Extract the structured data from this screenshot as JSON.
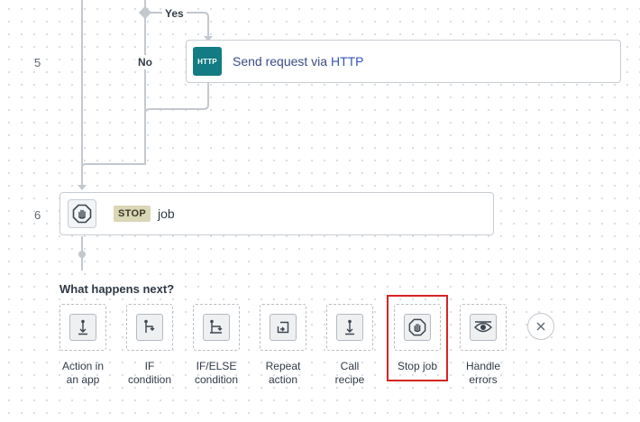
{
  "branches": {
    "yes_label": "Yes",
    "no_label": "No"
  },
  "steps": [
    {
      "number": "5",
      "badge": "HTTP",
      "text_plain": "Send request via",
      "text_link": "HTTP"
    },
    {
      "number": "6",
      "badge": "STOP",
      "text": "job"
    }
  ],
  "next": {
    "heading": "What happens next?",
    "options": [
      {
        "line1": "Action in",
        "line2": "an app"
      },
      {
        "line1": "IF",
        "line2": "condition"
      },
      {
        "line1": "IF/ELSE",
        "line2": "condition"
      },
      {
        "line1": "Repeat",
        "line2": "action"
      },
      {
        "line1": "Call",
        "line2": "recipe"
      },
      {
        "line1": "Stop job",
        "line2": ""
      },
      {
        "line1": "Handle",
        "line2": "errors"
      }
    ],
    "selected_index": 5
  },
  "colors": {
    "http_badge": "#127c82",
    "stop_badge": "#dad7b6",
    "highlight": "#d62424",
    "link": "#2f56b8"
  }
}
